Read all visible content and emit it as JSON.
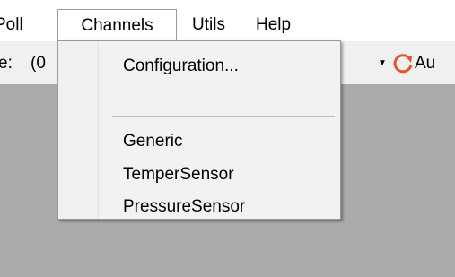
{
  "menubar": {
    "items": [
      "Poll",
      "Channels",
      "Utils",
      "Help"
    ]
  },
  "toolbar": {
    "label": "e:",
    "value": "(0",
    "auto_label": "Au"
  },
  "dropdown": {
    "items": [
      "Configuration...",
      "Generic",
      "TemperSensor",
      "PressureSensor"
    ]
  },
  "colors": {
    "menu_background": "#ffffff",
    "dropdown_background": "#f2f2f2",
    "client_area": "#ababab",
    "refresh_icon": "#e4572e"
  }
}
